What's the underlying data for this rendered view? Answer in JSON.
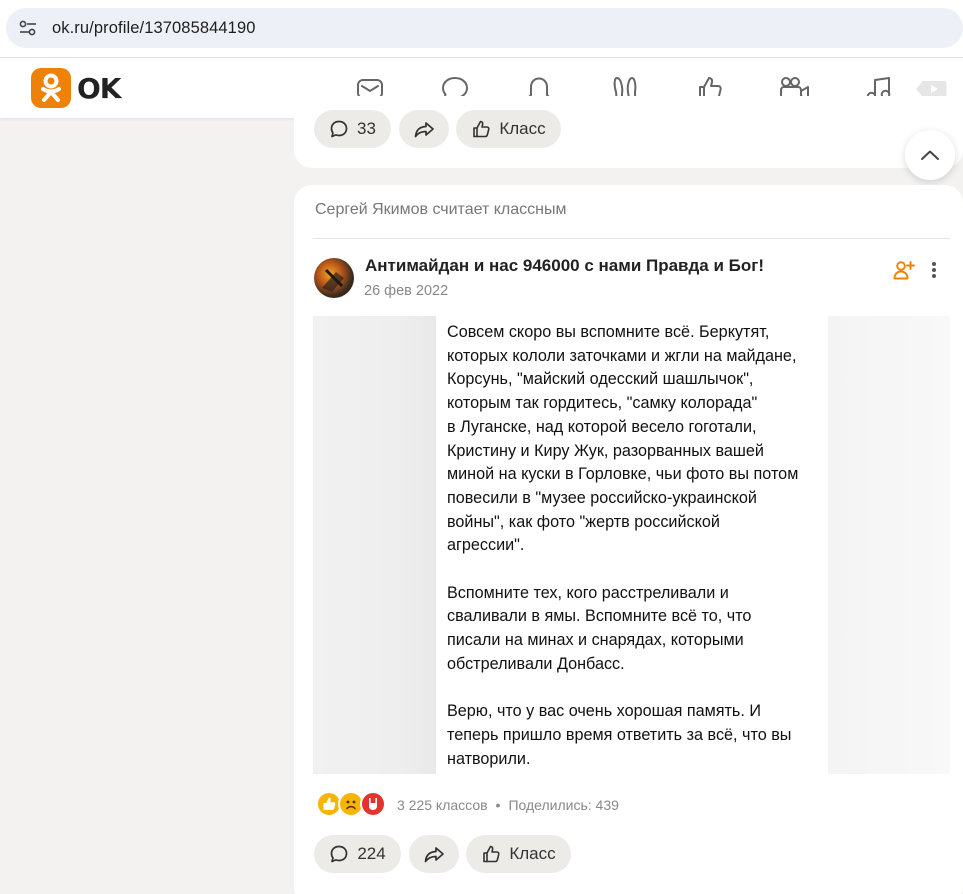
{
  "browser": {
    "url": "ok.ru/profile/137085844190"
  },
  "header": {
    "logo_text": "OK",
    "nav_icons": [
      "mail-icon",
      "chat-icon",
      "bell-icon",
      "guests-icon",
      "like-icon",
      "video-icon",
      "music-icon",
      "play-icon"
    ]
  },
  "prev_post": {
    "comments": "33",
    "klass_label": "Класс"
  },
  "feed_item": {
    "activity": "Сергей Якимов считает классным",
    "group_name": "Антимайдан и нас 946000 с нами Правда и Бог!",
    "date": "26 фев 2022",
    "image_text": {
      "paragraph1": [
        "Совсем скоро вы вспомните всё. Беркутят,",
        "которых кололи заточками и жгли на майдане,",
        "Корсунь, \"майский одесский шашлычок\",",
        "которым так гордитесь, \"самку колорада\"",
        "в Луганске, над которой весело гоготали,",
        "Кристину и Киру Жук, разорванных вашей",
        "миной на куски в Горловке, чьи фото вы потом",
        "повесили в \"музее российско-украинской",
        "войны\", как фото \"жертв российской",
        "агрессии\"."
      ],
      "paragraph2": [
        "Вспомните тех, кого расстреливали и",
        "сваливали в ямы. Вспомните всё то, что",
        "писали на минах и снарядах, которыми",
        "обстреливали Донбасс."
      ],
      "paragraph3": [
        "Верю, что у вас очень хорошая память. И",
        "теперь пришло время ответить за всё, что вы",
        "натворили."
      ]
    },
    "klasses": "3 225 классов",
    "separator": "•",
    "shares": "Поделились: 439",
    "comments": "224",
    "klass_label": "Класс"
  },
  "colors": {
    "brand": "#ee8208",
    "background": "#f4f2f0",
    "pill": "#edebe8"
  }
}
